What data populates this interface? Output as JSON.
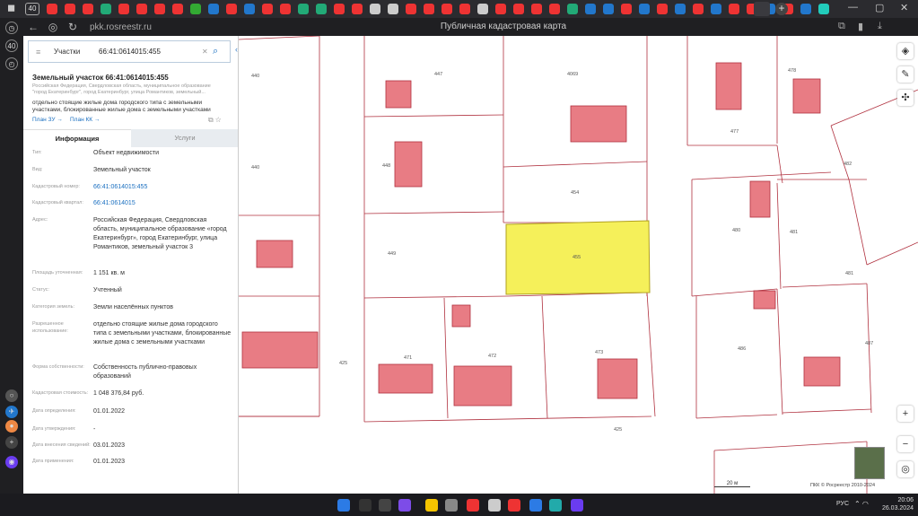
{
  "browser": {
    "tab_count": "40",
    "url": "pkk.rosreestr.ru",
    "title": "Публичная кадастровая карта",
    "tab_colors": [
      "#e33",
      "#e33",
      "#e33",
      "#2a7",
      "#e33",
      "#e33",
      "#e33",
      "#e33",
      "#3a3",
      "#27c",
      "#e33",
      "#27c",
      "#e33",
      "#e33",
      "#2a7",
      "#2a7",
      "#e33",
      "#e33",
      "#ccc",
      "#ccc",
      "#e33",
      "#e33",
      "#e33",
      "#e33",
      "#ccc",
      "#e33",
      "#e33",
      "#e33",
      "#e33",
      "#2a7",
      "#27c",
      "#27c",
      "#e33",
      "#27c",
      "#e33",
      "#27c",
      "#e33",
      "#27c",
      "#e33",
      "#e33",
      "#27c",
      "#e33",
      "#27c",
      "#2cb"
    ],
    "rail_number": "40"
  },
  "search": {
    "type": "Участки",
    "value": "66:41:0614015:455"
  },
  "object": {
    "title": "Земельный участок 66:41:0614015:455",
    "address_short": "Российская Федерация, Свердловская область, муниципальное образование \"город Екатеринбург\", город Екатеринбург, улица Романтиков, земельный...",
    "use": "отдельно стоящие жилые дома городского типа с земельными участками, блокированные жилые дома с земельными участками",
    "plan_zu": "План ЗУ →",
    "plan_kk": "План КК →"
  },
  "tabs": {
    "info": "Информация",
    "services": "Услуги"
  },
  "rows": [
    {
      "k": "Тип:",
      "v": "Объект недвижимости"
    },
    {
      "k": "Вид:",
      "v": "Земельный участок"
    },
    {
      "k": "Кадастровый номер:",
      "v": "66:41:0614015:455",
      "link": true
    },
    {
      "k": "Кадастровый квартал:",
      "v": "66:41:0614015",
      "link": true
    },
    {
      "k": "Адрес:",
      "v": "Российская Федерация, Свердловская область, муниципальное образование «город Екатеринбург», город Екатеринбург, улица Романтиков, земельный участок 3"
    },
    {
      "k": "Площадь уточненная:",
      "v": "1 151 кв. м"
    },
    {
      "k": "Статус:",
      "v": "Учтенный"
    },
    {
      "k": "Категория земель:",
      "v": "Земли населённых пунктов"
    },
    {
      "k": "Разрешенное использование:",
      "v": "отдельно стоящие жилые дома городского типа с земельными участками, блокированные жилые дома с земельными участками"
    },
    {
      "k": "Форма собственности:",
      "v": "Собственность публично-правовых образований"
    },
    {
      "k": "Кадастровая стоимость:",
      "v": "1 048 376,84 руб."
    },
    {
      "k": "Дата определения:",
      "v": "01.01.2022"
    },
    {
      "k": "Дата утверждения:",
      "v": "-"
    },
    {
      "k": "Дата внесения сведений:",
      "v": "03.01.2023"
    },
    {
      "k": "Дата применения:",
      "v": "01.01.2023"
    }
  ],
  "map": {
    "parcel_labels": [
      "440",
      "447",
      "4069",
      "477",
      "478",
      "440",
      "448",
      "454",
      "480",
      "481",
      "482",
      "449",
      "455",
      "481",
      "486",
      "487",
      "425",
      "471",
      "472",
      "473",
      "425"
    ],
    "highlight_color": "#f5f05a",
    "building_color": "#e87c84",
    "boundary_color": "#b0313f",
    "copyright": "ПКК © Росреестр 2010-2024",
    "scale": "20 м"
  },
  "taskbar": {
    "lang": "РУС",
    "time": "20:06",
    "date": "26.03.2024"
  }
}
